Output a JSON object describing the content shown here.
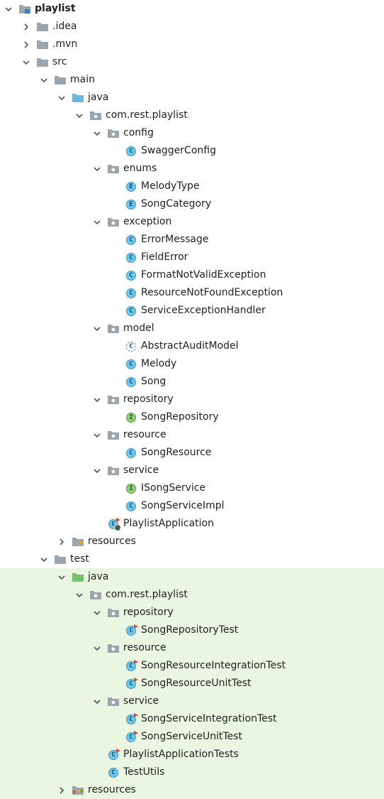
{
  "colors": {
    "test_background": "#eaf6e2",
    "folder": "#9aa5ae",
    "source_folder": "#6fb4dd",
    "test_folder": "#74c26d"
  },
  "tree": [
    {
      "depth": 0,
      "label": "playlist",
      "icon": "module-icon",
      "expanded": true,
      "bold": true
    },
    {
      "depth": 1,
      "label": ".idea",
      "icon": "folder-icon",
      "expanded": false
    },
    {
      "depth": 1,
      "label": ".mvn",
      "icon": "folder-icon",
      "expanded": false
    },
    {
      "depth": 1,
      "label": "src",
      "icon": "folder-icon",
      "expanded": true
    },
    {
      "depth": 2,
      "label": "main",
      "icon": "folder-icon",
      "expanded": true
    },
    {
      "depth": 3,
      "label": "java",
      "icon": "source-folder-icon",
      "expanded": true
    },
    {
      "depth": 4,
      "label": "com.rest.playlist",
      "icon": "package-icon",
      "expanded": true
    },
    {
      "depth": 5,
      "label": "config",
      "icon": "package-icon",
      "expanded": true
    },
    {
      "depth": 6,
      "label": "SwaggerConfig",
      "icon": "class-icon"
    },
    {
      "depth": 5,
      "label": "enums",
      "icon": "package-icon",
      "expanded": true
    },
    {
      "depth": 6,
      "label": "MelodyType",
      "icon": "enum-icon"
    },
    {
      "depth": 6,
      "label": "SongCategory",
      "icon": "enum-icon"
    },
    {
      "depth": 5,
      "label": "exception",
      "icon": "package-icon",
      "expanded": true
    },
    {
      "depth": 6,
      "label": "ErrorMessage",
      "icon": "class-icon"
    },
    {
      "depth": 6,
      "label": "FieldError",
      "icon": "class-icon"
    },
    {
      "depth": 6,
      "label": "FormatNotValidException",
      "icon": "class-icon"
    },
    {
      "depth": 6,
      "label": "ResourceNotFoundException",
      "icon": "class-icon"
    },
    {
      "depth": 6,
      "label": "ServiceExceptionHandler",
      "icon": "class-icon"
    },
    {
      "depth": 5,
      "label": "model",
      "icon": "package-icon",
      "expanded": true
    },
    {
      "depth": 6,
      "label": "AbstractAuditModel",
      "icon": "abstract-class-icon"
    },
    {
      "depth": 6,
      "label": "Melody",
      "icon": "class-icon"
    },
    {
      "depth": 6,
      "label": "Song",
      "icon": "class-icon"
    },
    {
      "depth": 5,
      "label": "repository",
      "icon": "package-icon",
      "expanded": true
    },
    {
      "depth": 6,
      "label": "SongRepository",
      "icon": "interface-icon"
    },
    {
      "depth": 5,
      "label": "resource",
      "icon": "package-icon",
      "expanded": true
    },
    {
      "depth": 6,
      "label": "SongResource",
      "icon": "class-icon"
    },
    {
      "depth": 5,
      "label": "service",
      "icon": "package-icon",
      "expanded": true
    },
    {
      "depth": 6,
      "label": "ISongService",
      "icon": "interface-icon"
    },
    {
      "depth": 6,
      "label": "SongServiceImpl",
      "icon": "class-icon"
    },
    {
      "depth": 5,
      "label": "PlaylistApplication",
      "icon": "spring-boot-class-icon"
    },
    {
      "depth": 3,
      "label": "resources",
      "icon": "resources-folder-icon",
      "expanded": false
    },
    {
      "depth": 2,
      "label": "test",
      "icon": "folder-icon",
      "expanded": true
    },
    {
      "depth": 3,
      "label": "java",
      "icon": "test-source-folder-icon",
      "expanded": true,
      "test": true
    },
    {
      "depth": 4,
      "label": "com.rest.playlist",
      "icon": "package-icon",
      "expanded": true,
      "test": true
    },
    {
      "depth": 5,
      "label": "repository",
      "icon": "package-icon",
      "expanded": true,
      "test": true
    },
    {
      "depth": 6,
      "label": "SongRepositoryTest",
      "icon": "test-class-icon",
      "test": true
    },
    {
      "depth": 5,
      "label": "resource",
      "icon": "package-icon",
      "expanded": true,
      "test": true
    },
    {
      "depth": 6,
      "label": "SongResourceIntegrationTest",
      "icon": "test-class-icon",
      "test": true
    },
    {
      "depth": 6,
      "label": "SongResourceUnitTest",
      "icon": "test-class-icon",
      "test": true
    },
    {
      "depth": 5,
      "label": "service",
      "icon": "package-icon",
      "expanded": true,
      "test": true
    },
    {
      "depth": 6,
      "label": "SongServiceIntegrationTest",
      "icon": "test-class-icon",
      "test": true
    },
    {
      "depth": 6,
      "label": "SongServiceUnitTest",
      "icon": "test-class-icon",
      "test": true
    },
    {
      "depth": 5,
      "label": "PlaylistApplicationTests",
      "icon": "test-class-icon",
      "test": true
    },
    {
      "depth": 5,
      "label": "TestUtils",
      "icon": "class-icon",
      "test": true
    },
    {
      "depth": 3,
      "label": "resources",
      "icon": "test-resources-folder-icon",
      "expanded": false,
      "test": true
    }
  ]
}
